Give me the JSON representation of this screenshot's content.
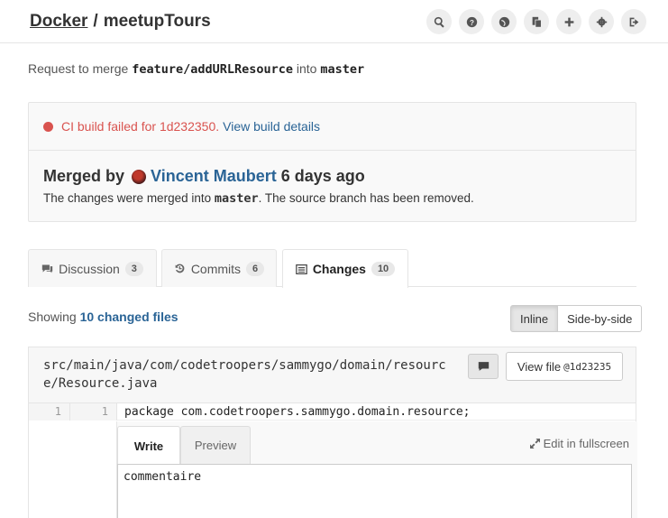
{
  "header": {
    "group": "Docker",
    "separator": "/",
    "project": "meetupTours",
    "icons": [
      "search-icon",
      "help-icon",
      "globe-icon",
      "copy-icon",
      "plus-icon",
      "gear-icon",
      "sign-out-icon"
    ]
  },
  "request": {
    "prefix": "Request to merge",
    "source_branch": "feature/addURLResource",
    "into": "into",
    "target_branch": "master"
  },
  "ci": {
    "message": "CI build failed for 1d232350.",
    "link": "View build details",
    "color": "#d9534f"
  },
  "merge": {
    "label": "Merged by",
    "author": "Vincent Maubert",
    "time": "6 days ago",
    "note_prefix": "The changes were merged into",
    "note_branch": "master",
    "note_suffix": ". The source branch has been removed."
  },
  "tabs": [
    {
      "label": "Discussion",
      "count": "3"
    },
    {
      "label": "Commits",
      "count": "6"
    },
    {
      "label": "Changes",
      "count": "10"
    }
  ],
  "changes": {
    "showing": "Showing",
    "files_link": "10 changed files",
    "view_inline": "Inline",
    "view_side": "Side-by-side"
  },
  "file": {
    "path": "src/main/java/com/codetroopers/sammygo/domain/resource/Resource.java",
    "view_file": "View file",
    "view_file_sha": "@1d23235",
    "line_old": "1",
    "line_new": "1",
    "code": "package com.codetroopers.sammygo.domain.resource;"
  },
  "note_form": {
    "write_tab": "Write",
    "preview_tab": "Preview",
    "fullscreen": "Edit in fullscreen",
    "text": "commentaire"
  },
  "colors": {
    "link": "#2a6496",
    "error": "#d9534f"
  }
}
